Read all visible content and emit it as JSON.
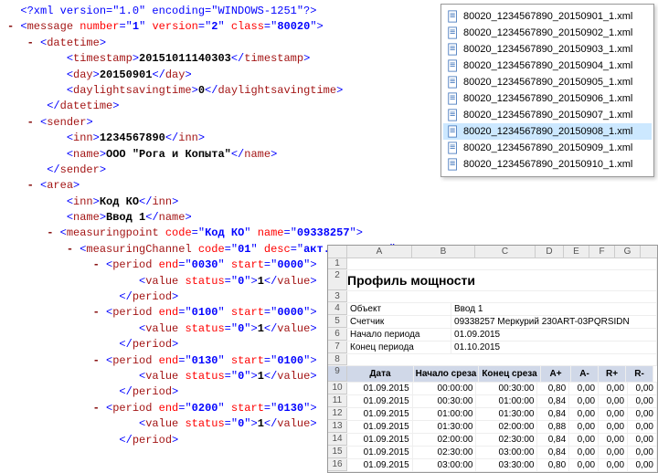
{
  "xml": {
    "decl": "<?xml version=\"1.0\" encoding=\"WINDOWS-1251\"?>",
    "msg_num": "1",
    "msg_ver": "2",
    "msg_cls": "80020",
    "timestamp": "20151011140303",
    "day": "20150901",
    "dst": "0",
    "sender_inn": "1234567890",
    "sender_name": "ООО \"Рога и Копыта\"",
    "area_inn": "Код КО",
    "area_name": "Ввод 1",
    "mp_code": "Код КО",
    "mp_name": "09338257",
    "mc_code": "01",
    "mc_desc": "акт. мощность",
    "periods": [
      {
        "end": "0030",
        "start": "0000",
        "status": "0",
        "val": "1"
      },
      {
        "end": "0100",
        "start": "0000",
        "status": "0",
        "val": "1"
      },
      {
        "end": "0130",
        "start": "0100",
        "status": "0",
        "val": "1"
      },
      {
        "end": "0200",
        "start": "0130",
        "status": "0",
        "val": "1"
      }
    ],
    "labels": {
      "datetime": "datetime",
      "timestamp": "timestamp",
      "day": "day",
      "dst": "daylightsavingtime",
      "sender": "sender",
      "inn": "inn",
      "name": "name",
      "area": "area",
      "mp": "measuringpoint",
      "mc": "measuringChannel",
      "period": "period",
      "value": "value",
      "end": "end",
      "start": "start",
      "status": "status",
      "code": "code",
      "desc": "desc",
      "message": "message",
      "number": "number",
      "version": "version",
      "class": "class"
    }
  },
  "files": [
    "80020_1234567890_20150901_1.xml",
    "80020_1234567890_20150902_1.xml",
    "80020_1234567890_20150903_1.xml",
    "80020_1234567890_20150904_1.xml",
    "80020_1234567890_20150905_1.xml",
    "80020_1234567890_20150906_1.xml",
    "80020_1234567890_20150907_1.xml",
    "80020_1234567890_20150908_1.xml",
    "80020_1234567890_20150909_1.xml",
    "80020_1234567890_20150910_1.xml"
  ],
  "files_selected": 7,
  "sheet": {
    "cols": [
      "A",
      "B",
      "C",
      "D",
      "E",
      "F",
      "G"
    ],
    "title": "Профиль мощности",
    "meta": [
      {
        "k": "Объект",
        "v": "Ввод 1"
      },
      {
        "k": "Счетчик",
        "v": "09338257 Меркурий 230ART-03PQRSIDN"
      },
      {
        "k": "Начало периода",
        "v": "01.09.2015"
      },
      {
        "k": "Конец периода",
        "v": "01.10.2015"
      }
    ],
    "hdr": [
      "Дата",
      "Начало среза",
      "Конец среза",
      "A+",
      "A-",
      "R+",
      "R-"
    ],
    "rows": [
      [
        "01.09.2015",
        "00:00:00",
        "00:30:00",
        "0,80",
        "0,00",
        "0,00",
        "0,00"
      ],
      [
        "01.09.2015",
        "00:30:00",
        "01:00:00",
        "0,84",
        "0,00",
        "0,00",
        "0,00"
      ],
      [
        "01.09.2015",
        "01:00:00",
        "01:30:00",
        "0,84",
        "0,00",
        "0,00",
        "0,00"
      ],
      [
        "01.09.2015",
        "01:30:00",
        "02:00:00",
        "0,88",
        "0,00",
        "0,00",
        "0,00"
      ],
      [
        "01.09.2015",
        "02:00:00",
        "02:30:00",
        "0,84",
        "0,00",
        "0,00",
        "0,00"
      ],
      [
        "01.09.2015",
        "02:30:00",
        "03:00:00",
        "0,84",
        "0,00",
        "0,00",
        "0,00"
      ],
      [
        "01.09.2015",
        "03:00:00",
        "03:30:00",
        "0,80",
        "0,00",
        "0,00",
        "0,00"
      ]
    ]
  }
}
